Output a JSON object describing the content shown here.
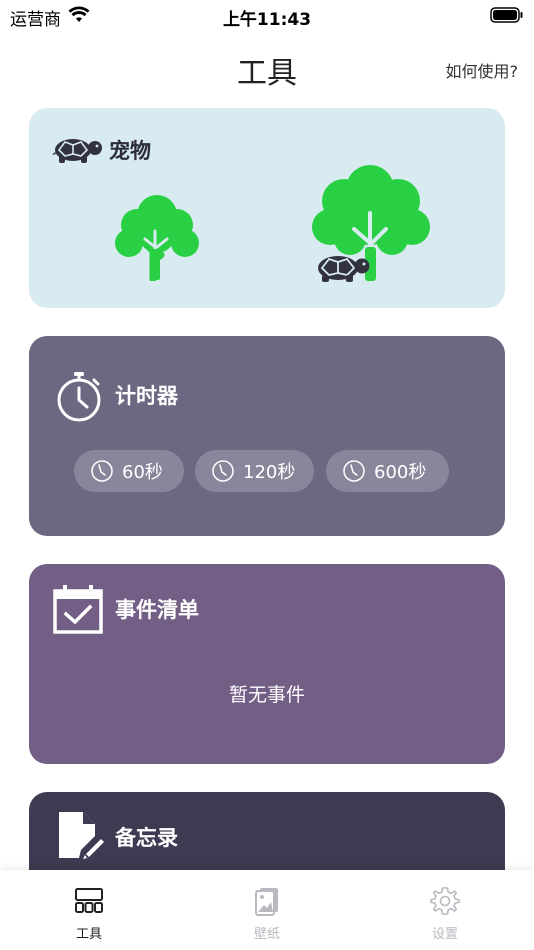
{
  "status_bar": {
    "carrier": "运营商",
    "time": "上午11:43"
  },
  "nav": {
    "title": "工具",
    "help_label": "如何使用?"
  },
  "cards": {
    "pet": {
      "title": "宠物",
      "icons": [
        "turtle-icon",
        "tree-icon"
      ]
    },
    "timer": {
      "title": "计时器",
      "presets": [
        {
          "label": "60秒"
        },
        {
          "label": "120秒"
        },
        {
          "label": "600秒"
        }
      ]
    },
    "events": {
      "title": "事件清单",
      "empty_text": "暂无事件"
    },
    "memo": {
      "title": "备忘录"
    }
  },
  "tab_bar": {
    "tabs": [
      {
        "label": "工具",
        "icon": "grid-icon",
        "selected": true
      },
      {
        "label": "壁纸",
        "icon": "wallpaper-icon",
        "selected": false
      },
      {
        "label": "设置",
        "icon": "gear-icon",
        "selected": false
      }
    ]
  },
  "colors": {
    "pet_card": "#d7ebf1",
    "timer_card": "#6b6882",
    "events_card": "#735e85",
    "memo_card": "#3f3a52",
    "tree_green": "#2ad044"
  }
}
